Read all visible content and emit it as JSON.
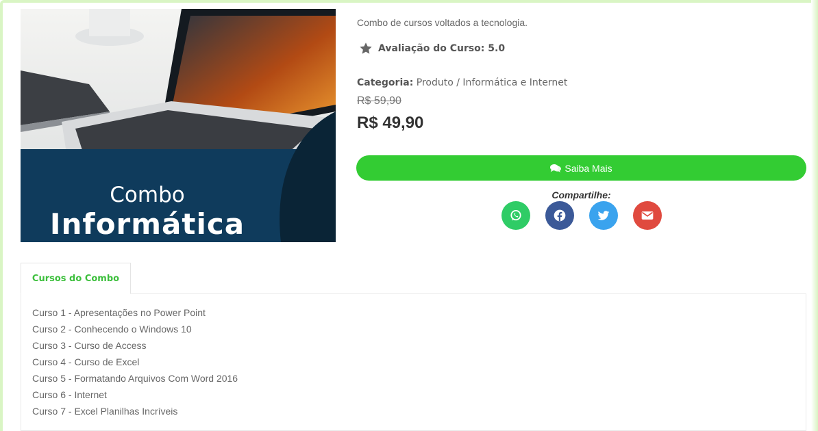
{
  "product": {
    "image_caption_line1": "Combo",
    "image_caption_line2": "Informática",
    "description": "Combo de cursos voltados a tecnologia.",
    "rating_text": "Avaliação do Curso: 5.0",
    "category_label": "Categoria:",
    "category_value": "Produto / Informática e Internet",
    "old_price": "R$ 59,90",
    "new_price": "R$ 49,90",
    "cta_label": "Saiba Mais",
    "share_label": "Compartilhe:"
  },
  "share": [
    {
      "name": "whatsapp",
      "icon": "whatsapp-icon",
      "color": "#2fcc66"
    },
    {
      "name": "facebook",
      "icon": "facebook-icon",
      "color": "#3b5998"
    },
    {
      "name": "twitter",
      "icon": "twitter-icon",
      "color": "#3aa3ee"
    },
    {
      "name": "email",
      "icon": "envelope-icon",
      "color": "#e04a3f"
    }
  ],
  "colors": {
    "accent_green": "#33cc33",
    "tab_green": "#3cbf3c",
    "image_navy": "#0f3b5c"
  },
  "tabs": [
    {
      "label": "Cursos do Combo",
      "active": true
    }
  ],
  "courses": [
    "Curso 1 - Apresentações no Power Point",
    "Curso 2 - Conhecendo o Windows 10",
    "Curso 3 - Curso de Access",
    "Curso 4 - Curso de Excel",
    "Curso 5 - Formatando Arquivos Com Word 2016",
    "Curso 6 - Internet",
    "Curso 7 - Excel Planilhas Incríveis"
  ]
}
